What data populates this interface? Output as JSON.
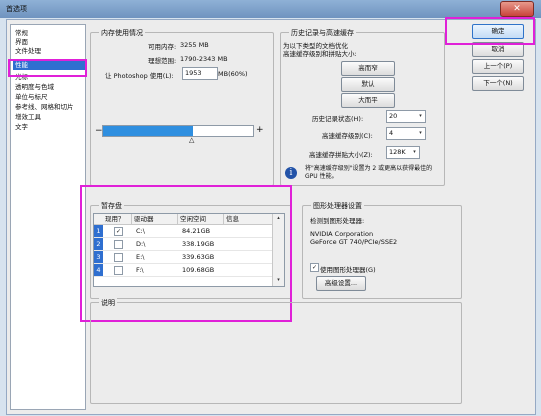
{
  "window": {
    "title": "首选项",
    "close_glyph": "✕"
  },
  "sidebar": {
    "items": [
      {
        "label": "常规"
      },
      {
        "label": "界面"
      },
      {
        "label": "文件处理"
      },
      {
        "label": "性能"
      },
      {
        "label": "光标"
      },
      {
        "label": "透明度与色域"
      },
      {
        "label": "单位与标尺"
      },
      {
        "label": "参考线、网格和切片"
      },
      {
        "label": "增效工具"
      },
      {
        "label": "文字"
      }
    ],
    "selected": "性能"
  },
  "memory": {
    "title": "内存使用情况",
    "available_label": "可用内存:",
    "available_value": "3255 MB",
    "ideal_label": "理想范围:",
    "ideal_value": "1790-2343 MB",
    "let_label": "让 Photoshop 使用(L):",
    "let_value": "1953",
    "let_unit": "MB(60%)",
    "minus": "−",
    "plus": "+",
    "slider_fraction": 0.6
  },
  "history": {
    "title": "历史记录与高速缓存",
    "desc_line1": "为以下类型的文档优化",
    "desc_line2": "高速缓存级别和拼贴大小:",
    "btn_tall": "高而窄",
    "btn_default": "默认",
    "btn_big": "大而平",
    "states_label": "历史记录状态(H):",
    "states_value": "20",
    "levels_label": "高速缓存级别(C):",
    "levels_value": "4",
    "tile_label": "高速缓存拼贴大小(Z):",
    "tile_value": "128K",
    "note_line1": "将\"高速缓存级别\"设置为 2 或更高以获得最佳的",
    "note_line2": "GPU 性能。"
  },
  "scratch": {
    "title": "暂存盘",
    "headers": [
      "现用？",
      "驱动器",
      "空闲空间",
      "信息"
    ],
    "rows": [
      {
        "num": "1",
        "active": "✓",
        "drive": "C:\\",
        "free": "84.21GB"
      },
      {
        "num": "2",
        "active": "",
        "drive": "D:\\",
        "free": "338.19GB"
      },
      {
        "num": "3",
        "active": "",
        "drive": "E:\\",
        "free": "339.63GB"
      },
      {
        "num": "4",
        "active": "",
        "drive": "F:\\",
        "free": "109.68GB"
      }
    ]
  },
  "gpu": {
    "title": "图形处理器设置",
    "detected_label": "检测到图形处理器:",
    "card_line1": "NVIDIA Corporation",
    "card_line2": "GeForce GT 740/PCIe/SSE2",
    "use_label": "使用图形处理器(G)",
    "advanced": "高级设置..."
  },
  "description": {
    "title": "说明"
  },
  "buttons": {
    "ok": "确定",
    "cancel": "取消",
    "prev": "上一个(P)",
    "next": "下一个(N)"
  },
  "colors": {
    "highlight": "#e020d8",
    "selection": "#2f6fd0"
  }
}
